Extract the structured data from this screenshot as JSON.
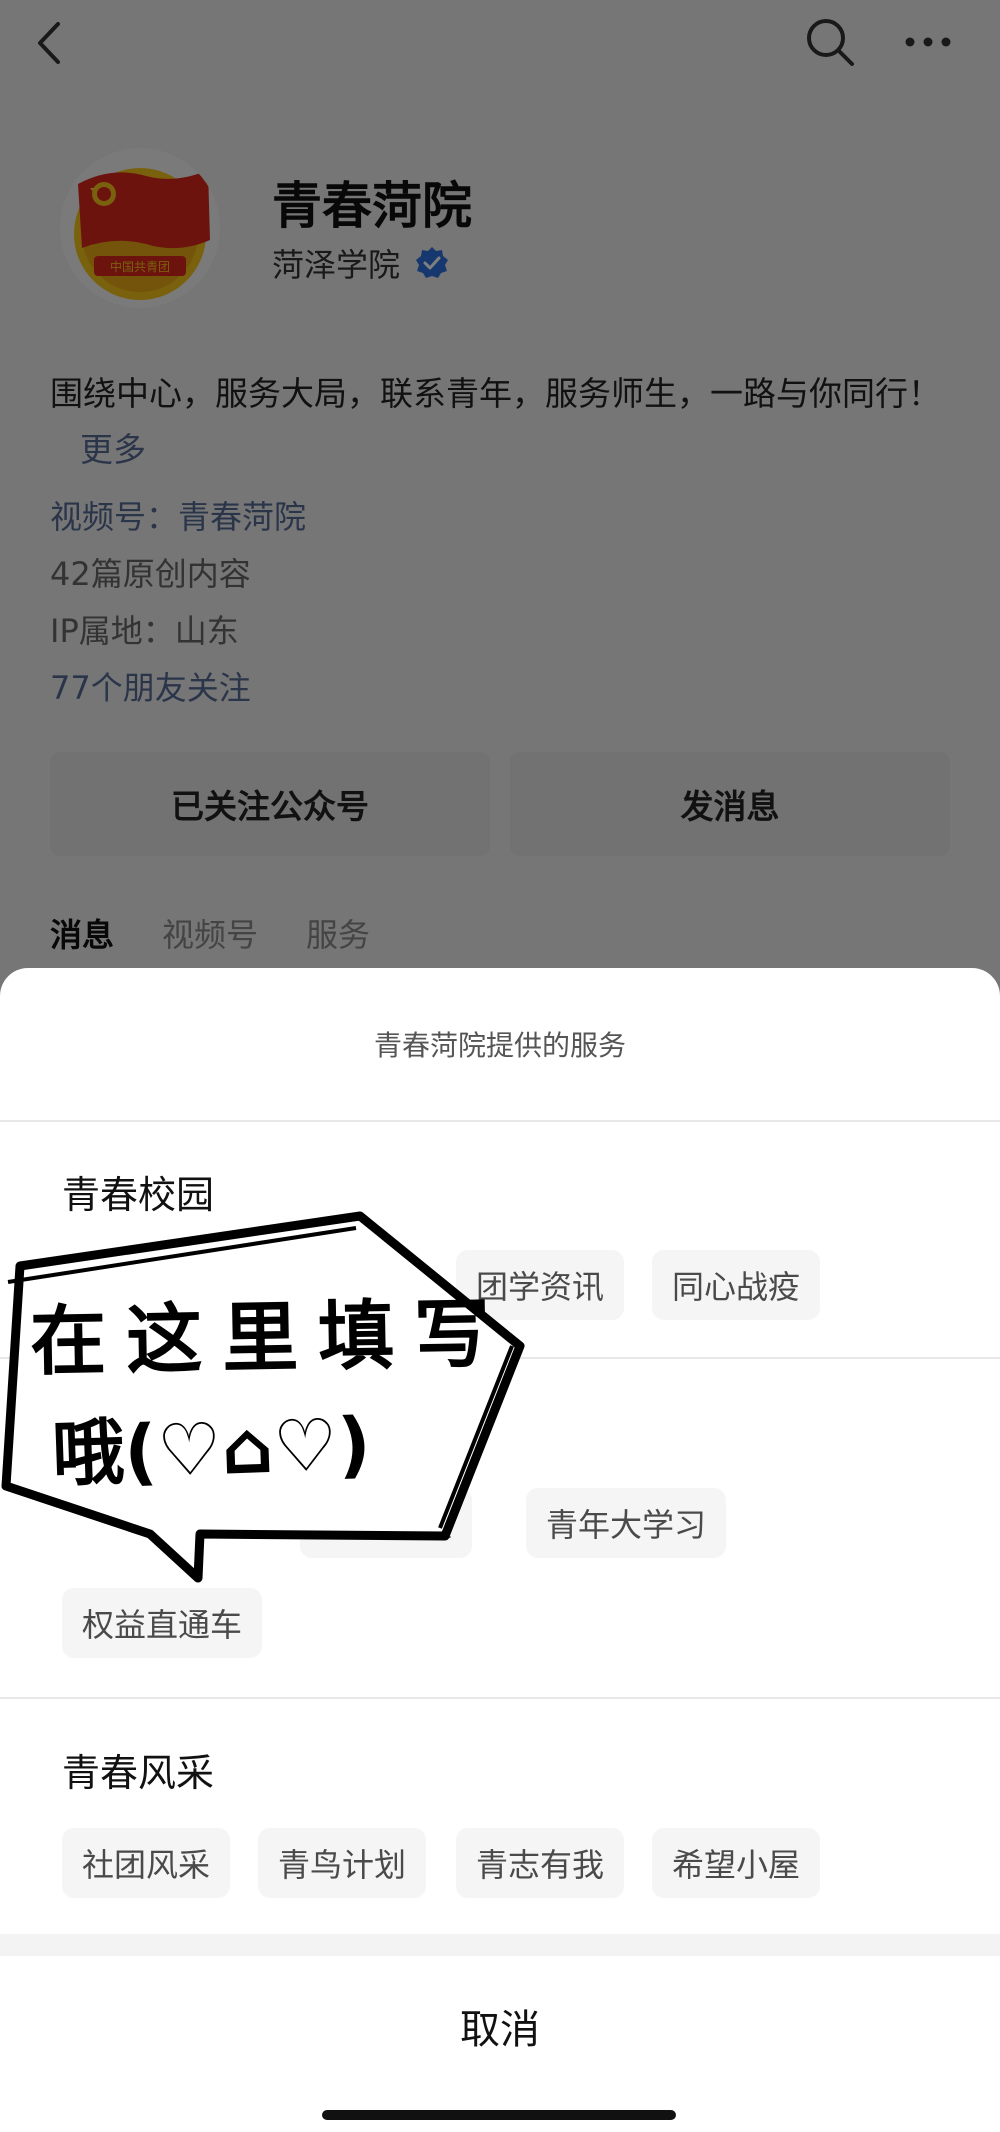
{
  "header": {
    "back_icon": "chevron-left-icon",
    "search_icon": "search-icon",
    "more_icon": "more-horizontal-icon"
  },
  "profile": {
    "name": "青春菏院",
    "owner": "菏泽学院",
    "description": "围绕中心，服务大局，联系青年，服务师生，一路与你同行！",
    "more_link": "更多",
    "meta": {
      "video_channel": "视频号：青春菏院",
      "original_count": "42篇原创内容",
      "ip_location": "IP属地：山东",
      "friends_following": "77个朋友关注"
    },
    "buttons": {
      "followed": "已关注公众号",
      "message": "发消息"
    },
    "tabs": [
      "消息",
      "视频号",
      "服务"
    ]
  },
  "sheet": {
    "title": "青春菏院提供的服务",
    "sections": [
      {
        "title": "青春校园",
        "chips": [
          "团学资讯",
          "同心战疫"
        ]
      },
      {
        "title": "",
        "chips": [
          "量",
          "青年大学习",
          "权益直通车"
        ]
      },
      {
        "title": "青春风采",
        "chips": [
          "社团风采",
          "青鸟计划",
          "青志有我",
          "希望小屋"
        ]
      }
    ],
    "cancel": "取消"
  },
  "sticker": {
    "line1": "在这里填写",
    "line2": "哦(♡⌂♡)"
  },
  "colors": {
    "link_blue": "#576b95",
    "verified_blue": "#2f6fde",
    "badge_red": "#d9261c",
    "badge_yellow": "#f2c21b"
  }
}
